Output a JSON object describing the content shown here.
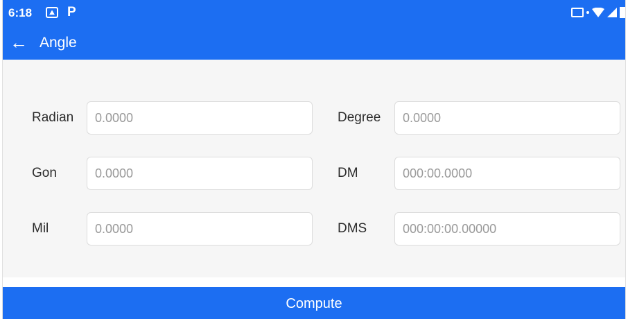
{
  "status_bar": {
    "time": "6:18",
    "notification_icons": [
      "gallery-icon",
      "p-icon"
    ],
    "system_icons": [
      "cast-icon",
      "wifi-icon",
      "signal-icon",
      "battery-icon"
    ],
    "p_glyph": "P"
  },
  "toolbar": {
    "back_icon": "arrow-left-icon",
    "title": "Angle"
  },
  "form": {
    "radian": {
      "label": "Radian",
      "placeholder": "0.0000"
    },
    "degree": {
      "label": "Degree",
      "placeholder": "0.0000"
    },
    "gon": {
      "label": "Gon",
      "placeholder": "0.0000"
    },
    "dm": {
      "label": "DM",
      "placeholder": "000:00.0000"
    },
    "mil": {
      "label": "Mil",
      "placeholder": "0.0000"
    },
    "dms": {
      "label": "DMS",
      "placeholder": "000:00:00.00000"
    }
  },
  "compute_button": {
    "label": "Compute"
  },
  "colors": {
    "accent": "#1c6ef2",
    "background": "#f6f6f6"
  }
}
